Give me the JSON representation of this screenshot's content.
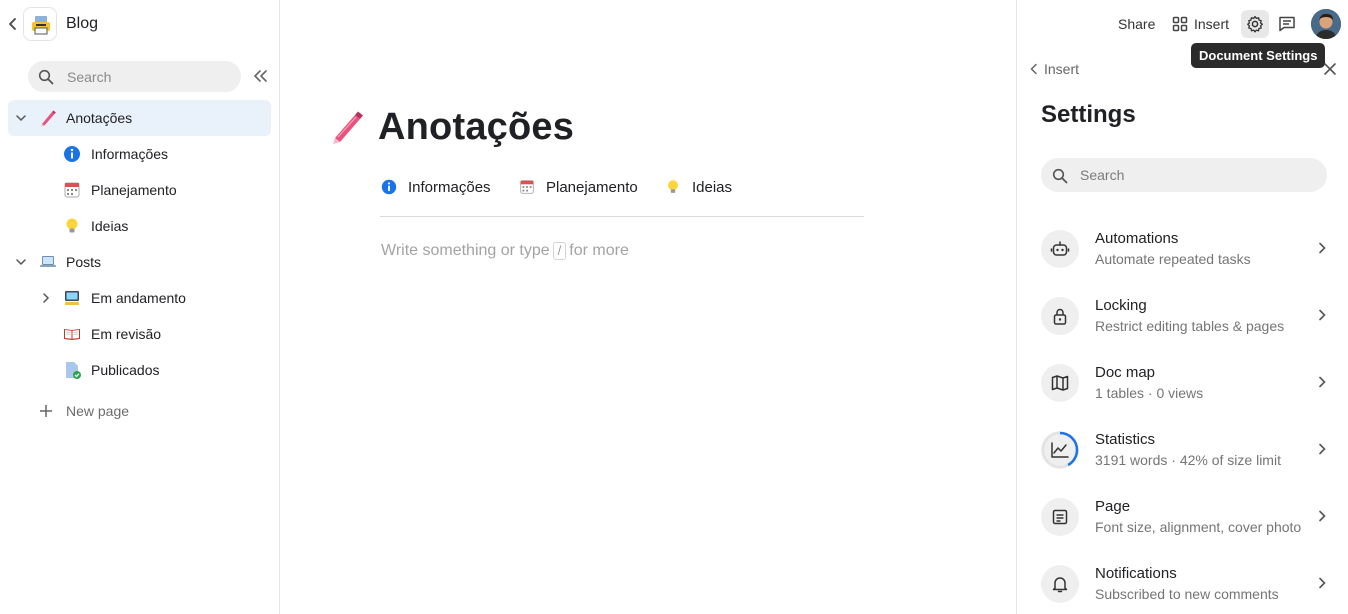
{
  "sidebar": {
    "doc_title": "Blog",
    "search_placeholder": "Search",
    "items": [
      {
        "label": "Anotações",
        "icon": "pen-icon"
      },
      {
        "label": "Informações",
        "icon": "info-icon"
      },
      {
        "label": "Planejamento",
        "icon": "calendar-icon"
      },
      {
        "label": "Ideias",
        "icon": "lightbulb-icon"
      },
      {
        "label": "Posts",
        "icon": "laptop-icon"
      },
      {
        "label": "Em andamento",
        "icon": "computer-icon"
      },
      {
        "label": "Em revisão",
        "icon": "book-icon"
      },
      {
        "label": "Publicados",
        "icon": "document-check-icon"
      }
    ],
    "new_page_label": "New page"
  },
  "main": {
    "title": "Anotações",
    "subpages": [
      {
        "label": "Informações"
      },
      {
        "label": "Planejamento"
      },
      {
        "label": "Ideias"
      }
    ],
    "placeholder_before": "Write something or type",
    "placeholder_key": "/",
    "placeholder_after": "for more"
  },
  "topbar": {
    "share_label": "Share",
    "insert_label": "Insert",
    "tooltip": "Document Settings"
  },
  "panel": {
    "back_label": "Insert",
    "title": "Settings",
    "search_placeholder": "Search",
    "items": [
      {
        "title": "Automations",
        "desc": "Automate repeated tasks"
      },
      {
        "title": "Locking",
        "desc": "Restrict editing tables & pages"
      },
      {
        "title": "Doc map",
        "desc": "1 tables · 0 views"
      },
      {
        "title": "Statistics",
        "desc": "3191 words · 42% of size limit",
        "size_used_fraction": 0.42
      },
      {
        "title": "Page",
        "desc": "Font size, alignment, cover photo"
      },
      {
        "title": "Notifications",
        "desc": "Subscribed to new comments"
      }
    ]
  },
  "colors": {
    "accent": "#1a73e8",
    "active_row": "#e9f1fb",
    "tooltip_bg": "#2b2b2b"
  }
}
